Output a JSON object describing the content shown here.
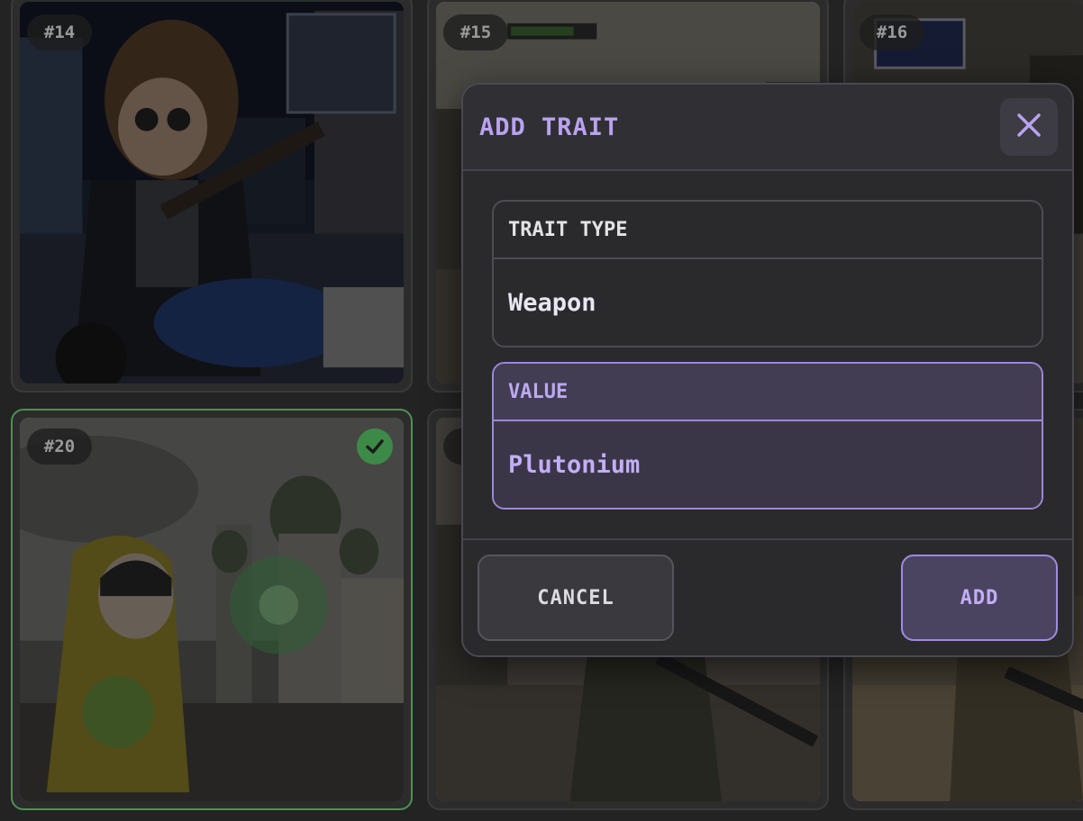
{
  "cards": [
    {
      "badge": "#14"
    },
    {
      "badge": "#15"
    },
    {
      "badge": "#16"
    },
    {
      "badge": "#20",
      "selected": true
    },
    {
      "badge": "#"
    },
    {
      "badge": ""
    }
  ],
  "modal": {
    "title": "ADD TRAIT",
    "fields": [
      {
        "label": "TRAIT TYPE",
        "value": "Weapon"
      },
      {
        "label": "VALUE",
        "value": "Plutonium"
      }
    ],
    "cancel_label": "CANCEL",
    "add_label": "ADD"
  },
  "colors": {
    "accent": "#b9a2ee",
    "selected_border": "#4f8f55",
    "check": "#3d8a48"
  },
  "icons": [
    "close-icon",
    "check-icon"
  ]
}
